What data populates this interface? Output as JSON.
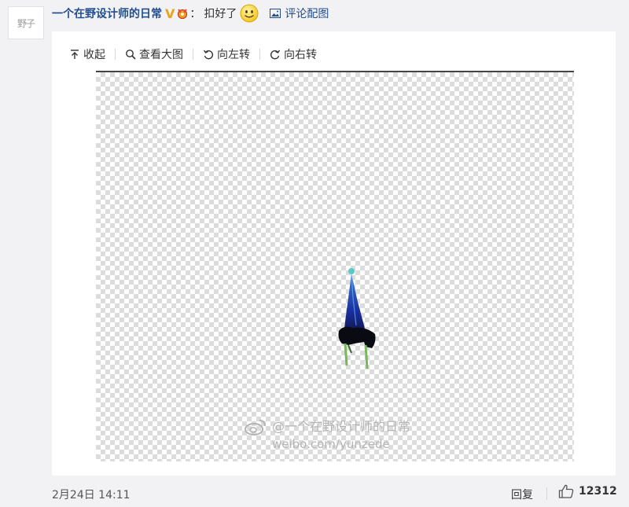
{
  "post": {
    "avatar_text": "野子",
    "username": "一个在野设计师的日常",
    "vip_badge": "V",
    "colon": "：",
    "comment_text": "扣好了",
    "comment_image_label": "评论配图",
    "timestamp": "2月24日 14:11"
  },
  "toolbar": {
    "collapse_label": "收起",
    "view_large_label": "查看大图",
    "rotate_left_label": "向左转",
    "rotate_right_label": "向右转"
  },
  "image": {
    "watermark_line1": "@一个在野设计师的日常",
    "watermark_line2": "weibo.com/yunzede"
  },
  "actions": {
    "reply_label": "回复",
    "like_count": "12312"
  },
  "colors": {
    "link": "#1f4d8f",
    "vip": "#e8a317",
    "card_bg": "#ffffff",
    "page_bg": "#f2f2f5"
  }
}
